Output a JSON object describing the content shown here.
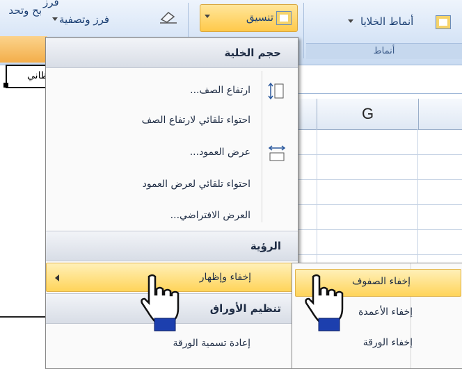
{
  "ribbon": {
    "sort_filter_label": "فرز وتصفية",
    "sort_line1": "فرز",
    "find_select_label": "بح وتحد",
    "format_label": "تنسيق",
    "cell_styles_label": "أنماط الخلايا",
    "styles_group_label": "أنماط"
  },
  "sheet": {
    "cell_text": "ظاني",
    "column_header": "G"
  },
  "menu": {
    "cell_size_header": "حجم الخلية",
    "row_height": "ارتفاع الصف...",
    "autofit_row_height": "احتواء تلقائي لارتفاع الصف",
    "column_width": "عرض العمود...",
    "autofit_column_width": "احتواء تلقائي لعرض العمود",
    "default_width": "العرض الافتراضي...",
    "visibility_header": "الرؤية",
    "hide_unhide": "إخفاء وإظهار",
    "organize_sheets_header": "تنظيم الأوراق",
    "rename_sheet": "إعادة تسمية الورقة"
  },
  "submenu": {
    "hide_rows": "إخفاء الصفوف",
    "hide_columns": "إخفاء الأعمدة",
    "hide_sheet": "إخفاء الورقة"
  },
  "icons": {
    "row_height_icon": "row-height-icon",
    "column_width_icon": "column-width-icon",
    "hand_cursor": "hand-pointer-icon"
  },
  "colors": {
    "highlight": "#ffd45a",
    "ribbon": "#d9e6f7",
    "header_text": "#1e2c44"
  }
}
